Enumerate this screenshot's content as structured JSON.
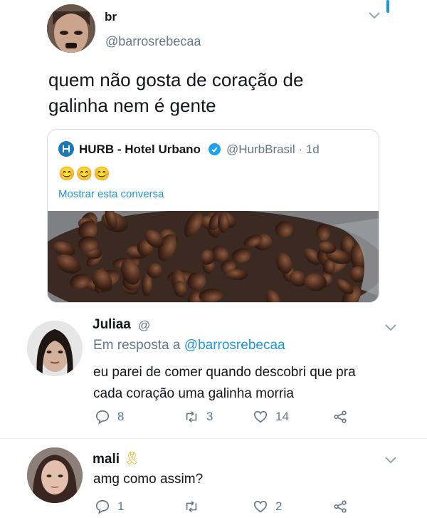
{
  "main_tweet": {
    "display_name": "br",
    "handle": "@barrosrebecaa",
    "text_line1": "quem não gosta de coração de",
    "text_line2": "galinha nem é gente"
  },
  "quoted_tweet": {
    "display_name": "HURB - Hotel Urbano",
    "handle": "@HurbBrasil",
    "separator": "·",
    "time": "1d",
    "emoji": "😊😊😊",
    "show_thread": "Mostrar esta conversa"
  },
  "replies": [
    {
      "display_name": "Juliaa",
      "reply_prefix": "Em resposta a",
      "reply_to": "@barrosrebecaa",
      "text_line1": "eu parei de comer quando descobri que pra",
      "text_line2": "cada coração uma galinha morria",
      "reply_count": "8",
      "retweet_count": "3",
      "like_count": "14"
    },
    {
      "display_name": "mali",
      "emoji": "🎗",
      "text": "amg como assim?",
      "reply_count": "1",
      "retweet_count": "",
      "like_count": "2"
    }
  ],
  "colors": {
    "link": "#1b95e0",
    "muted": "#657786",
    "text": "#14171a"
  }
}
